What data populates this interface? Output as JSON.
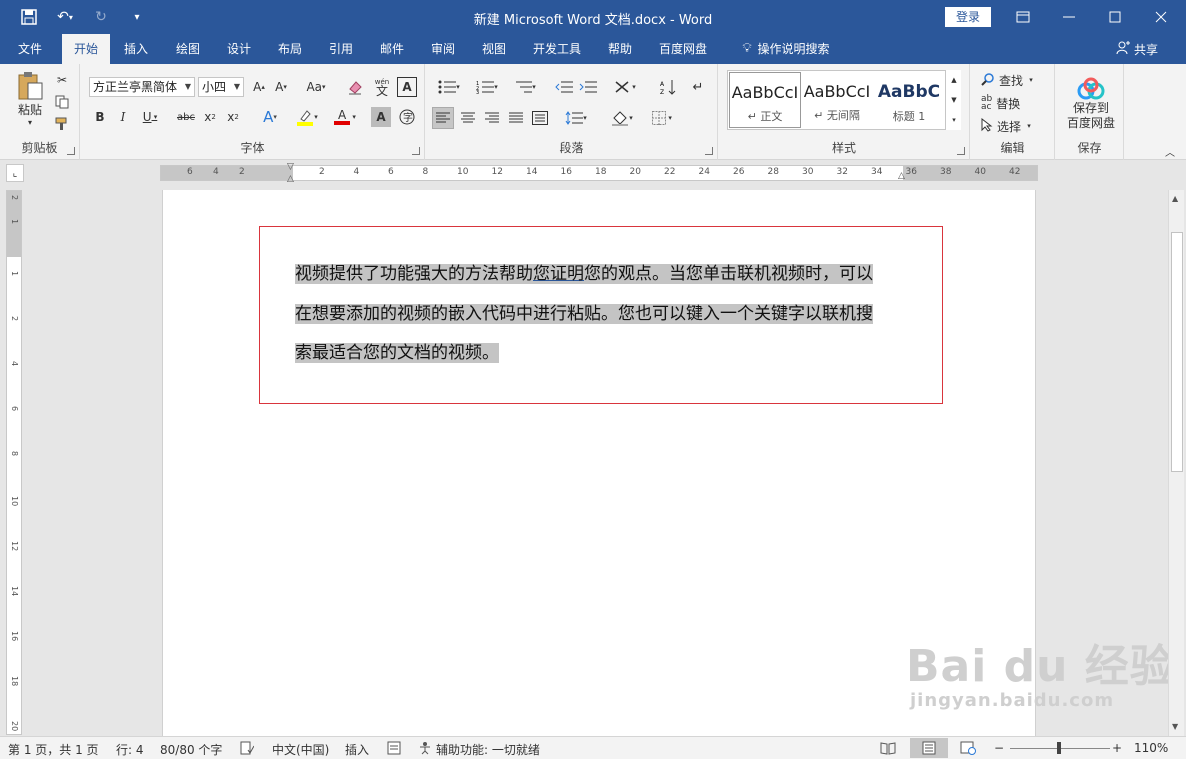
{
  "window": {
    "title": "新建 Microsoft Word 文档.docx  -  Word",
    "login": "登录"
  },
  "tabs": [
    "文件",
    "开始",
    "插入",
    "绘图",
    "设计",
    "布局",
    "引用",
    "邮件",
    "审阅",
    "视图",
    "开发工具",
    "帮助",
    "百度网盘"
  ],
  "active_tab": "开始",
  "tell_me": "操作说明搜索",
  "share": "共享",
  "ribbon": {
    "clipboard": {
      "paste": "粘贴",
      "label": "剪贴板"
    },
    "font": {
      "name": "方正兰亭黑简体",
      "size": "小四",
      "label": "字体",
      "wen": "wén"
    },
    "paragraph": {
      "label": "段落"
    },
    "styles": {
      "label": "样式",
      "items": [
        {
          "preview": "AaBbCcI",
          "name": "正文"
        },
        {
          "preview": "AaBbCcI",
          "name": "无间隔"
        },
        {
          "preview": "AaBbC",
          "name": "标题 1"
        }
      ]
    },
    "editing": {
      "find": "查找",
      "replace": "替换",
      "select": "选择",
      "label": "编辑"
    },
    "save": {
      "line1": "保存到",
      "line2": "百度网盘",
      "label": "保存"
    }
  },
  "ruler": {
    "labels": [
      "6",
      "4",
      "2",
      "2",
      "4",
      "6",
      "8",
      "10",
      "12",
      "14",
      "16",
      "18",
      "20",
      "22",
      "24",
      "26",
      "28",
      "30",
      "32",
      "34",
      "36",
      "38",
      "40",
      "42"
    ],
    "vlabels": [
      "2",
      "1",
      "1",
      "2",
      "4",
      "6",
      "8",
      "10",
      "12",
      "14",
      "16",
      "18",
      "20"
    ]
  },
  "document": {
    "seg1": "视频提供了功能强大的方法帮助",
    "seg2": "您证明",
    "seg3": "您的观点。当您单击联机视频时，可以",
    "line2": "在想要添加的视频的嵌入代码中进行粘贴。您也可以键入一个关键字以联机搜",
    "line3": "索最适合您的文档的视频。"
  },
  "watermark": {
    "line1": "Bai du 经验",
    "line2": "jingyan.baidu.com"
  },
  "status": {
    "page": "第 1 页，共 1 页",
    "line": "行: 4",
    "words": "80/80 个字",
    "lang": "中文(中国)",
    "mode": "插入",
    "accessibility": "辅助功能: 一切就绪",
    "zoom": "110%"
  },
  "colors": {
    "accent": "#2b579a",
    "selection": "#c4c4c4",
    "box_border": "#d9353d"
  }
}
